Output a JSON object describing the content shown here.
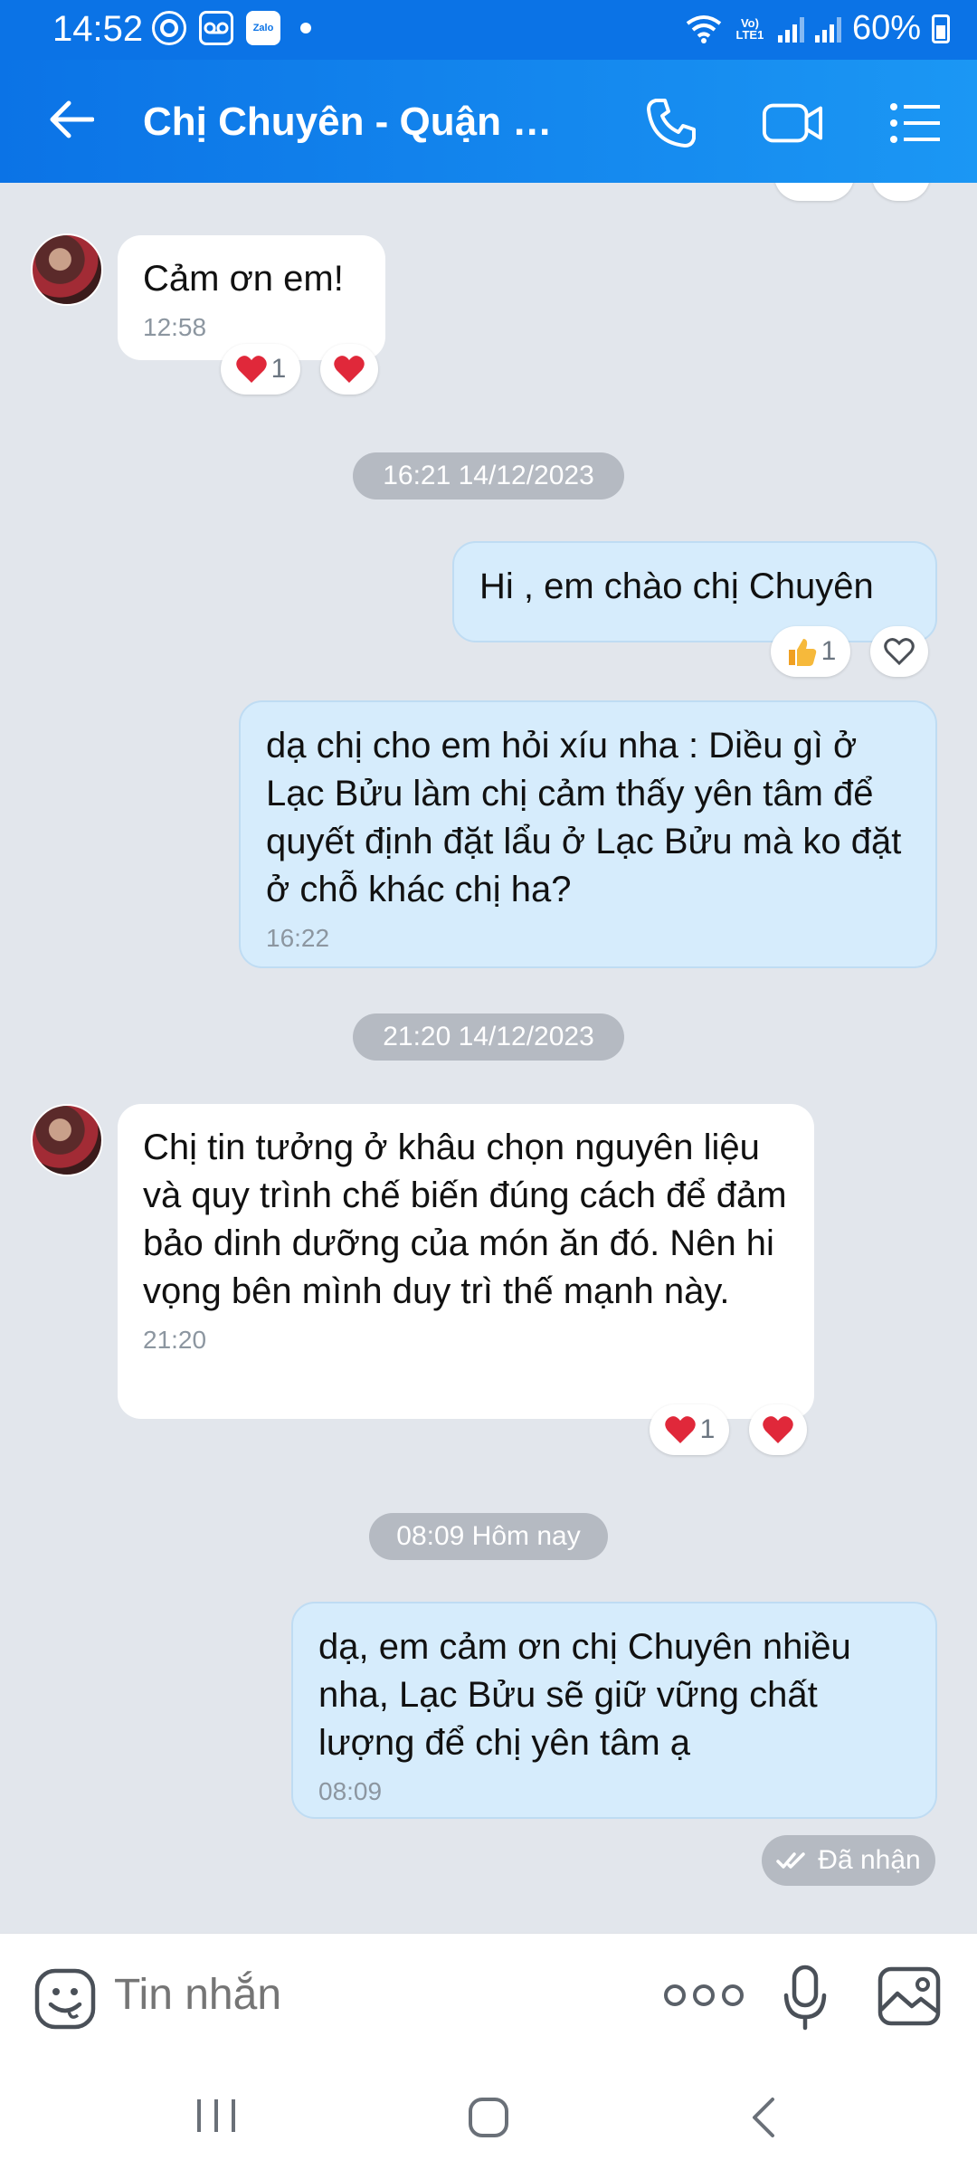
{
  "status_bar": {
    "time": "14:52",
    "zalo_label": "Zalo",
    "lte_label": "Vo) LTE1",
    "battery": "60%"
  },
  "header": {
    "title": "Chị Chuyên - Quận 10..."
  },
  "messages": [
    {
      "text": "Cảm ơn em!",
      "time": "12:58",
      "reaction_count": "1"
    },
    {
      "date": "16:21 14/12/2023"
    },
    {
      "text": "Hi , em chào chị Chuyên",
      "reaction_count": "1"
    },
    {
      "text": "dạ chị cho em hỏi xíu nha : Diều gì ở Lạc Bửu làm chị cảm thấy yên tâm để quyết định đặt lẩu ở Lạc Bửu mà ko đặt ở chỗ khác chị ha?",
      "time": "16:22"
    },
    {
      "date": "21:20 14/12/2023"
    },
    {
      "text": "Chị tin tưởng ở khâu chọn nguyên liệu và quy trình chế biến đúng cách để đảm bảo dinh dưỡng của món ăn đó. Nên hi vọng bên mình duy trì thế mạnh này.",
      "time": "21:20",
      "reaction_count": "1"
    },
    {
      "date": "08:09 Hôm nay"
    },
    {
      "text": "dạ, em cảm ơn chị Chuyên nhiều nha, Lạc Bửu sẽ giữ vững chất lượng để chị yên tâm ạ",
      "time": "08:09"
    }
  ],
  "delivery_status": "Đã nhận",
  "input": {
    "placeholder": "Tin nhắn"
  }
}
